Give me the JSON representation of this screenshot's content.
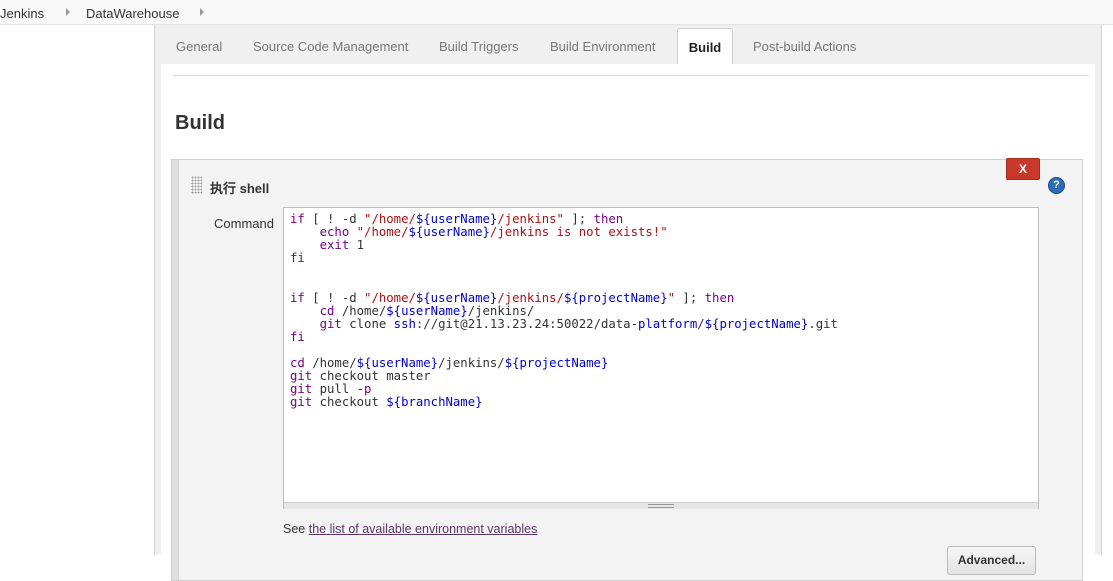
{
  "breadcrumb": {
    "items": [
      "Jenkins",
      "DataWarehouse"
    ]
  },
  "tabs": {
    "general": "General",
    "scm": "Source Code Management",
    "triggers": "Build Triggers",
    "environment": "Build Environment",
    "build": "Build",
    "post_build": "Post-build Actions"
  },
  "section": {
    "title": "Build"
  },
  "step": {
    "title": "执行 shell",
    "delete_label": "X",
    "help_label": "?",
    "command_label": "Command"
  },
  "command": {
    "lines": [
      "if [ ! -d \"/home/${userName}/jenkins\" ]; then",
      "    echo \"/home/${userName}/jenkins is not exists!\"",
      "    exit 1",
      "fi",
      "",
      "",
      "if [ ! -d \"/home/${userName}/jenkins/${projectName}\" ]; then",
      "    cd /home/${userName}/jenkins/",
      "    git clone ssh://git@21.13.23.24:50022/data-platform/${projectName}.git",
      "fi",
      "",
      "cd /home/${userName}/jenkins/${projectName}",
      "git checkout master",
      "git pull -p",
      "git checkout ${branchName}"
    ]
  },
  "env": {
    "prefix": "See",
    "link_text": "the list of available environment variables"
  },
  "advanced": {
    "label": "Advanced..."
  },
  "colors": {
    "keyword": "#770088",
    "string": "#aa1111",
    "variable": "#0000cc",
    "delete": "#c8392b",
    "help": "#2e6cb5"
  }
}
